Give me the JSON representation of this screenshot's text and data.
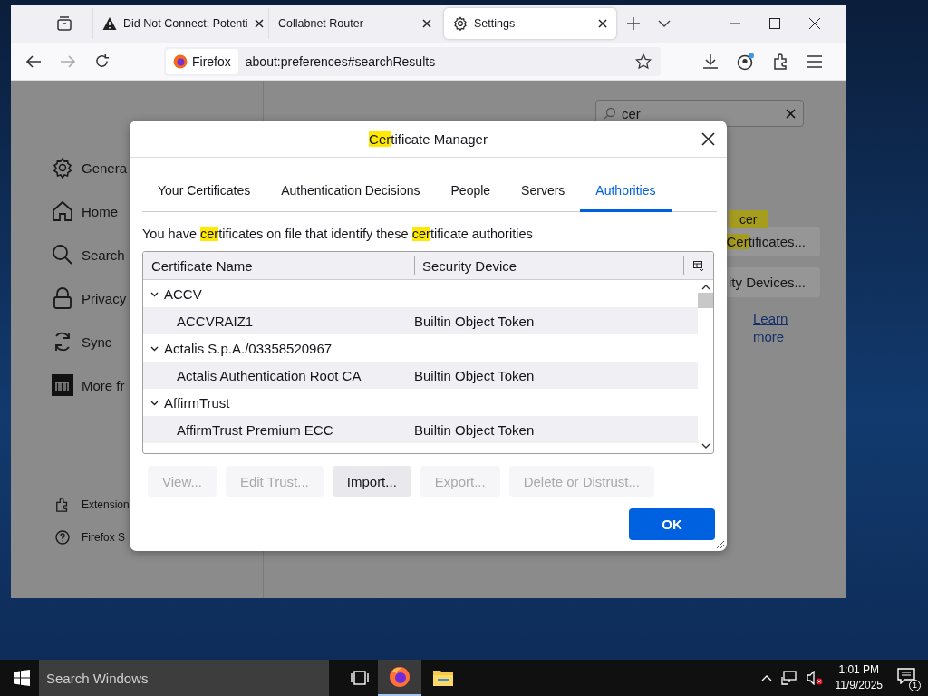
{
  "browser": {
    "tabs": [
      {
        "title": "Did Not Connect: Potenti",
        "selected": false
      },
      {
        "title": "Collabnet Router",
        "selected": false
      },
      {
        "title": "Settings",
        "selected": true
      }
    ],
    "address": {
      "identity": "Firefox",
      "url": "about:preferences#searchResults"
    }
  },
  "settings": {
    "nav": [
      {
        "label": "Genera"
      },
      {
        "label": "Home"
      },
      {
        "label": "Search"
      },
      {
        "label": "Privacy"
      },
      {
        "label": "Sync"
      },
      {
        "label": "More fr"
      }
    ],
    "footer": [
      {
        "label": "Extension"
      },
      {
        "label": "Firefox S"
      }
    ],
    "search": {
      "value": "cer"
    },
    "tooltip": "cer",
    "buttons": [
      [
        {
          "text": "Cer",
          "highlight": true
        },
        {
          "text": "tificates...",
          "highlight": false
        }
      ],
      [
        {
          "text": "ity Devices...",
          "highlight": false
        }
      ]
    ],
    "link": "Learn more"
  },
  "dialog": {
    "title": [
      {
        "text": "Cer",
        "highlight": true
      },
      {
        "text": "tificate Manager",
        "highlight": false
      }
    ],
    "tabs": [
      {
        "label": "Your Certificates",
        "selected": false
      },
      {
        "label": "Authentication Decisions",
        "selected": false
      },
      {
        "label": "People",
        "selected": false
      },
      {
        "label": "Servers",
        "selected": false
      },
      {
        "label": "Authorities",
        "selected": true
      }
    ],
    "description": [
      {
        "text": "You have ",
        "highlight": false
      },
      {
        "text": "cer",
        "highlight": true
      },
      {
        "text": "tificates on file that identify these ",
        "highlight": false
      },
      {
        "text": "cer",
        "highlight": true
      },
      {
        "text": "tificate authorities",
        "highlight": false
      }
    ],
    "columns": [
      "Certificate Name",
      "Security Device"
    ],
    "rows": [
      {
        "kind": "group",
        "name": "ACCV",
        "expanded": true
      },
      {
        "kind": "cert",
        "name": "ACCVRAIZ1",
        "device": "Builtin Object Token"
      },
      {
        "kind": "group",
        "name": "Actalis S.p.A./03358520967",
        "expanded": true
      },
      {
        "kind": "cert",
        "name": "Actalis Authentication Root CA",
        "device": "Builtin Object Token"
      },
      {
        "kind": "group",
        "name": "AffirmTrust",
        "expanded": true
      },
      {
        "kind": "cert",
        "name": "AffirmTrust Premium ECC",
        "device": "Builtin Object Token"
      }
    ],
    "buttons": [
      {
        "label": "View...",
        "disabled": true
      },
      {
        "label": "Edit Trust...",
        "disabled": true
      },
      {
        "label": "Import...",
        "disabled": false
      },
      {
        "label": "Export...",
        "disabled": true
      },
      {
        "label": "Delete or Distrust...",
        "disabled": true
      }
    ],
    "ok": "OK"
  },
  "taskbar": {
    "search_placeholder": "Search Windows",
    "apps": [
      {
        "active": true
      },
      {
        "active": false
      }
    ],
    "time": "1:01 PM",
    "date": "11/9/2025",
    "notifications": "1"
  }
}
